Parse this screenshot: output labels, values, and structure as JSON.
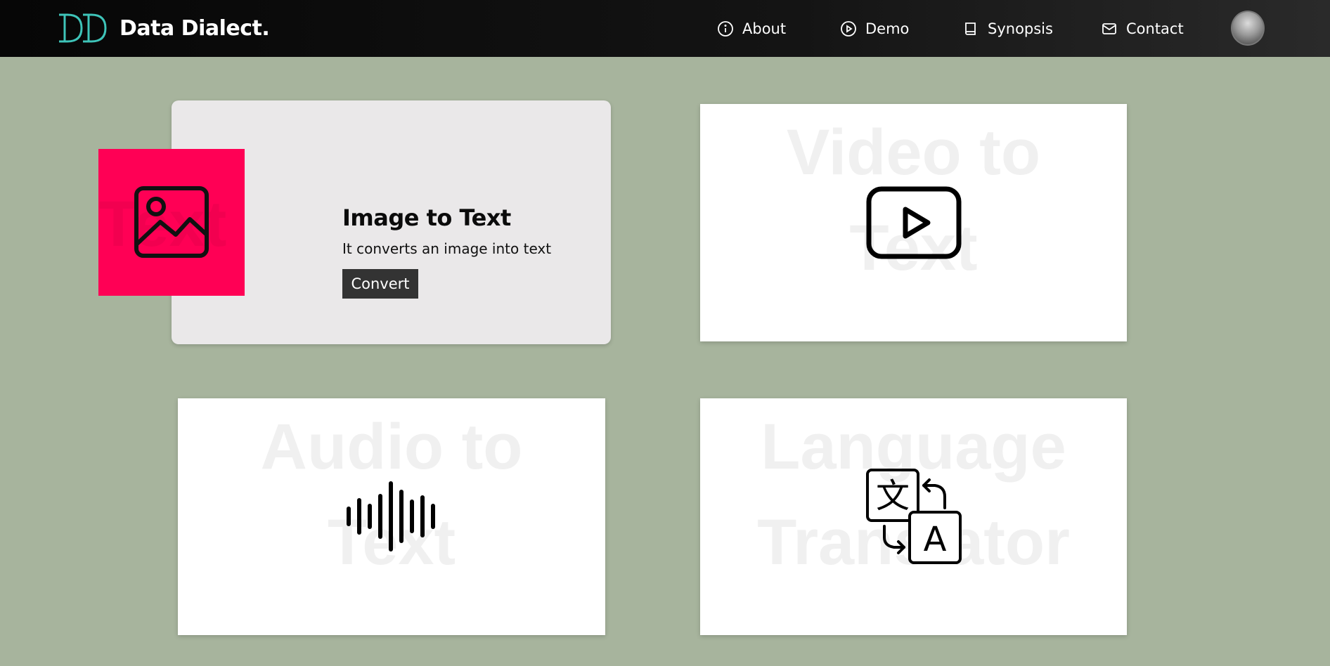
{
  "brand": {
    "name": "Data Dialect.",
    "logo_icon": "dd-monogram-icon",
    "accent": "#3ec4b9"
  },
  "nav": {
    "items": [
      {
        "label": "About",
        "icon": "info-circle-icon"
      },
      {
        "label": "Demo",
        "icon": "play-circle-icon"
      },
      {
        "label": "Synopsis",
        "icon": "book-icon"
      },
      {
        "label": "Contact",
        "icon": "envelope-icon"
      }
    ],
    "avatar": "user-avatar"
  },
  "cards": {
    "image_to_text": {
      "title": "Image to Text",
      "description": "It converts an image into text",
      "button": "Convert",
      "icon": "image-icon",
      "accent": "#ff0055"
    },
    "video_to_text": {
      "bg_line1": "Video to",
      "bg_line2": "Text",
      "icon": "play-box-icon"
    },
    "audio_to_text": {
      "bg_line1": "Audio to",
      "bg_line2": "Text",
      "icon": "sound-wave-icon"
    },
    "language_translator": {
      "bg_line1": "Language",
      "bg_line2": "Translator",
      "icon": "translate-icon",
      "glyph_source": "文",
      "glyph_target": "A"
    }
  },
  "colors": {
    "page_bg": "#a7b49d",
    "button_bg": "#333333",
    "nav_bg": "#0a0a0a"
  }
}
